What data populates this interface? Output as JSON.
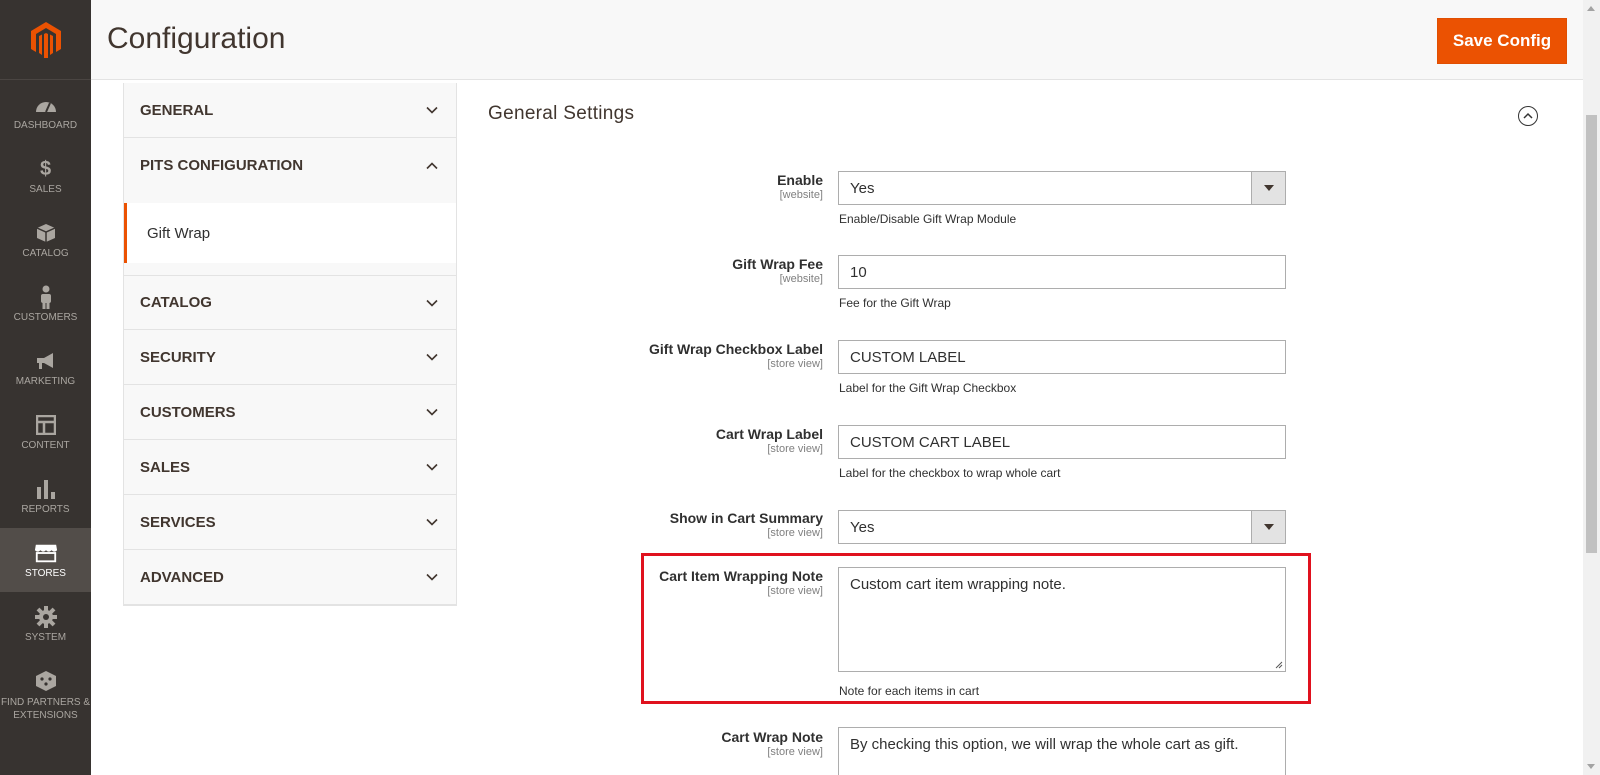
{
  "app": {
    "accent_color": "#eb5202",
    "nav_bg_color": "#373330"
  },
  "nav": {
    "items": [
      {
        "label": "DASHBOARD",
        "icon": "dashboard-icon"
      },
      {
        "label": "SALES",
        "icon": "dollar-icon"
      },
      {
        "label": "CATALOG",
        "icon": "cube-icon"
      },
      {
        "label": "CUSTOMERS",
        "icon": "person-icon"
      },
      {
        "label": "MARKETING",
        "icon": "megaphone-icon"
      },
      {
        "label": "CONTENT",
        "icon": "layout-icon"
      },
      {
        "label": "REPORTS",
        "icon": "bar-chart-icon"
      },
      {
        "label": "STORES",
        "icon": "store-icon",
        "active": true
      },
      {
        "label": "SYSTEM",
        "icon": "gear-icon"
      },
      {
        "label": "FIND PARTNERS & EXTENSIONS",
        "icon": "extensions-icon"
      }
    ]
  },
  "header": {
    "title": "Configuration",
    "save_label": "Save Config"
  },
  "tabs": {
    "general": "GENERAL",
    "pits": "PITS CONFIGURATION",
    "pits_sub": "Gift Wrap",
    "catalog": "CATALOG",
    "security": "SECURITY",
    "customers": "CUSTOMERS",
    "sales": "SALES",
    "services": "SERVICES",
    "advanced": "ADVANCED"
  },
  "section": {
    "title": "General Settings"
  },
  "fields": {
    "enable": {
      "label": "Enable",
      "scope": "[website]",
      "value": "Yes",
      "note": "Enable/Disable Gift Wrap Module"
    },
    "fee": {
      "label": "Gift Wrap Fee",
      "scope": "[website]",
      "value": "10",
      "note": "Fee for the Gift Wrap"
    },
    "checkbox_label": {
      "label": "Gift Wrap Checkbox Label",
      "scope": "[store view]",
      "value": "CUSTOM LABEL",
      "note": "Label for the Gift Wrap Checkbox"
    },
    "cart_wrap_label": {
      "label": "Cart Wrap Label",
      "scope": "[store view]",
      "value": "CUSTOM CART LABEL",
      "note": "Label for the checkbox to wrap whole cart"
    },
    "show_in_summary": {
      "label": "Show in Cart Summary",
      "scope": "[store view]",
      "value": "Yes"
    },
    "item_note": {
      "label": "Cart Item Wrapping Note",
      "scope": "[store view]",
      "value": "Custom cart item wrapping note.",
      "note": "Note for each items in cart"
    },
    "cart_note": {
      "label": "Cart Wrap Note",
      "scope": "[store view]",
      "value": "By checking this option, we will wrap the whole cart as gift."
    }
  }
}
